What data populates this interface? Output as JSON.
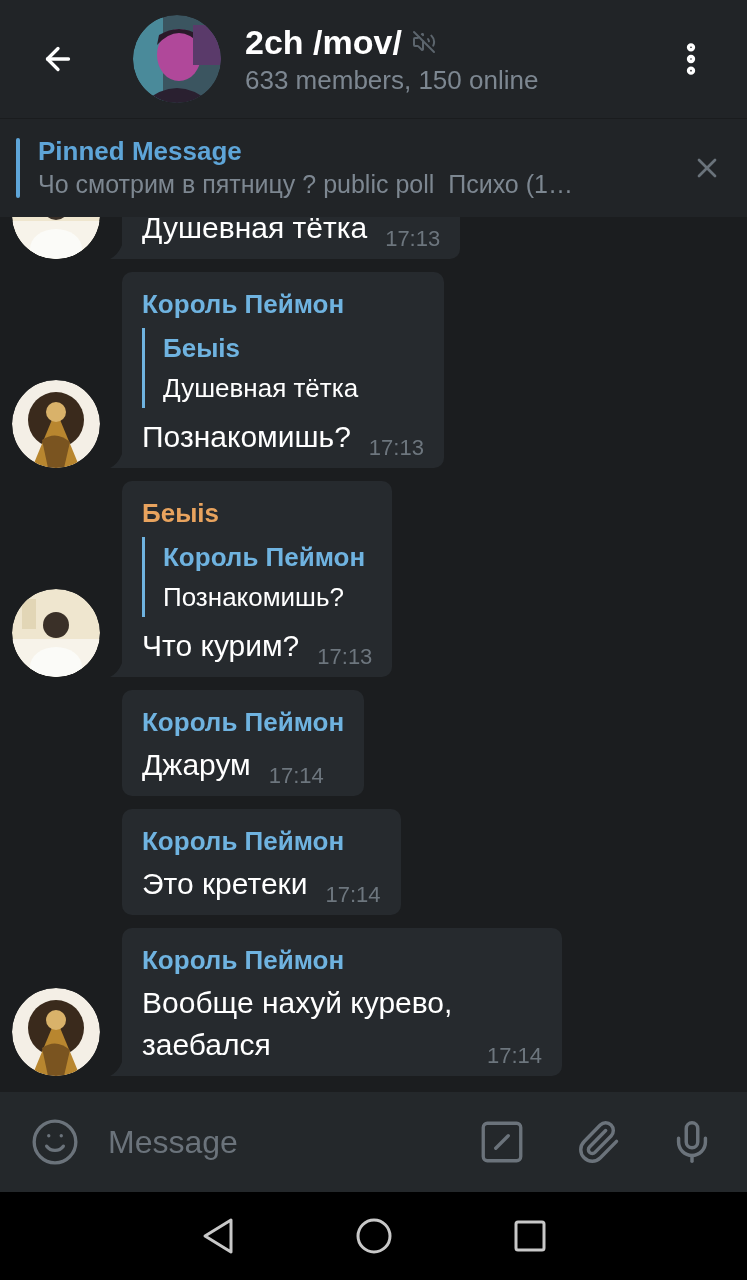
{
  "header": {
    "title": "2ch /mov/",
    "muted": true,
    "subtitle": "633 members, 150 online"
  },
  "pinned": {
    "title": "Pinned Message",
    "text": "Чо смотрим в пятницу ? public poll  Психо (1…"
  },
  "messages": [
    {
      "text": "Душевная тётка",
      "time": "17:13",
      "avatar": true
    },
    {
      "sender": "Король Пеймон",
      "color": "#6fb3e0",
      "reply": {
        "name": "Беыis",
        "text": "Душевная тётка"
      },
      "text": "Познакомишь?",
      "time": "17:13",
      "avatar": true
    },
    {
      "sender": "Беыis",
      "color": "#e8a35e",
      "reply": {
        "name": "Король Пеймон",
        "text": "Познакомишь?"
      },
      "text": "Что курим?",
      "time": "17:13",
      "avatar": true
    },
    {
      "sender": "Король Пеймон",
      "color": "#6fb3e0",
      "text": "Джарум",
      "time": "17:14",
      "avatar": false
    },
    {
      "sender": "Король Пеймон",
      "color": "#6fb3e0",
      "text": "Это кретеки",
      "time": "17:14",
      "avatar": false
    },
    {
      "sender": "Король Пеймон",
      "color": "#6fb3e0",
      "text": "Вообще нахуй курево, заебался",
      "time": "17:14",
      "avatar": true
    }
  ],
  "composer": {
    "placeholder": "Message"
  }
}
